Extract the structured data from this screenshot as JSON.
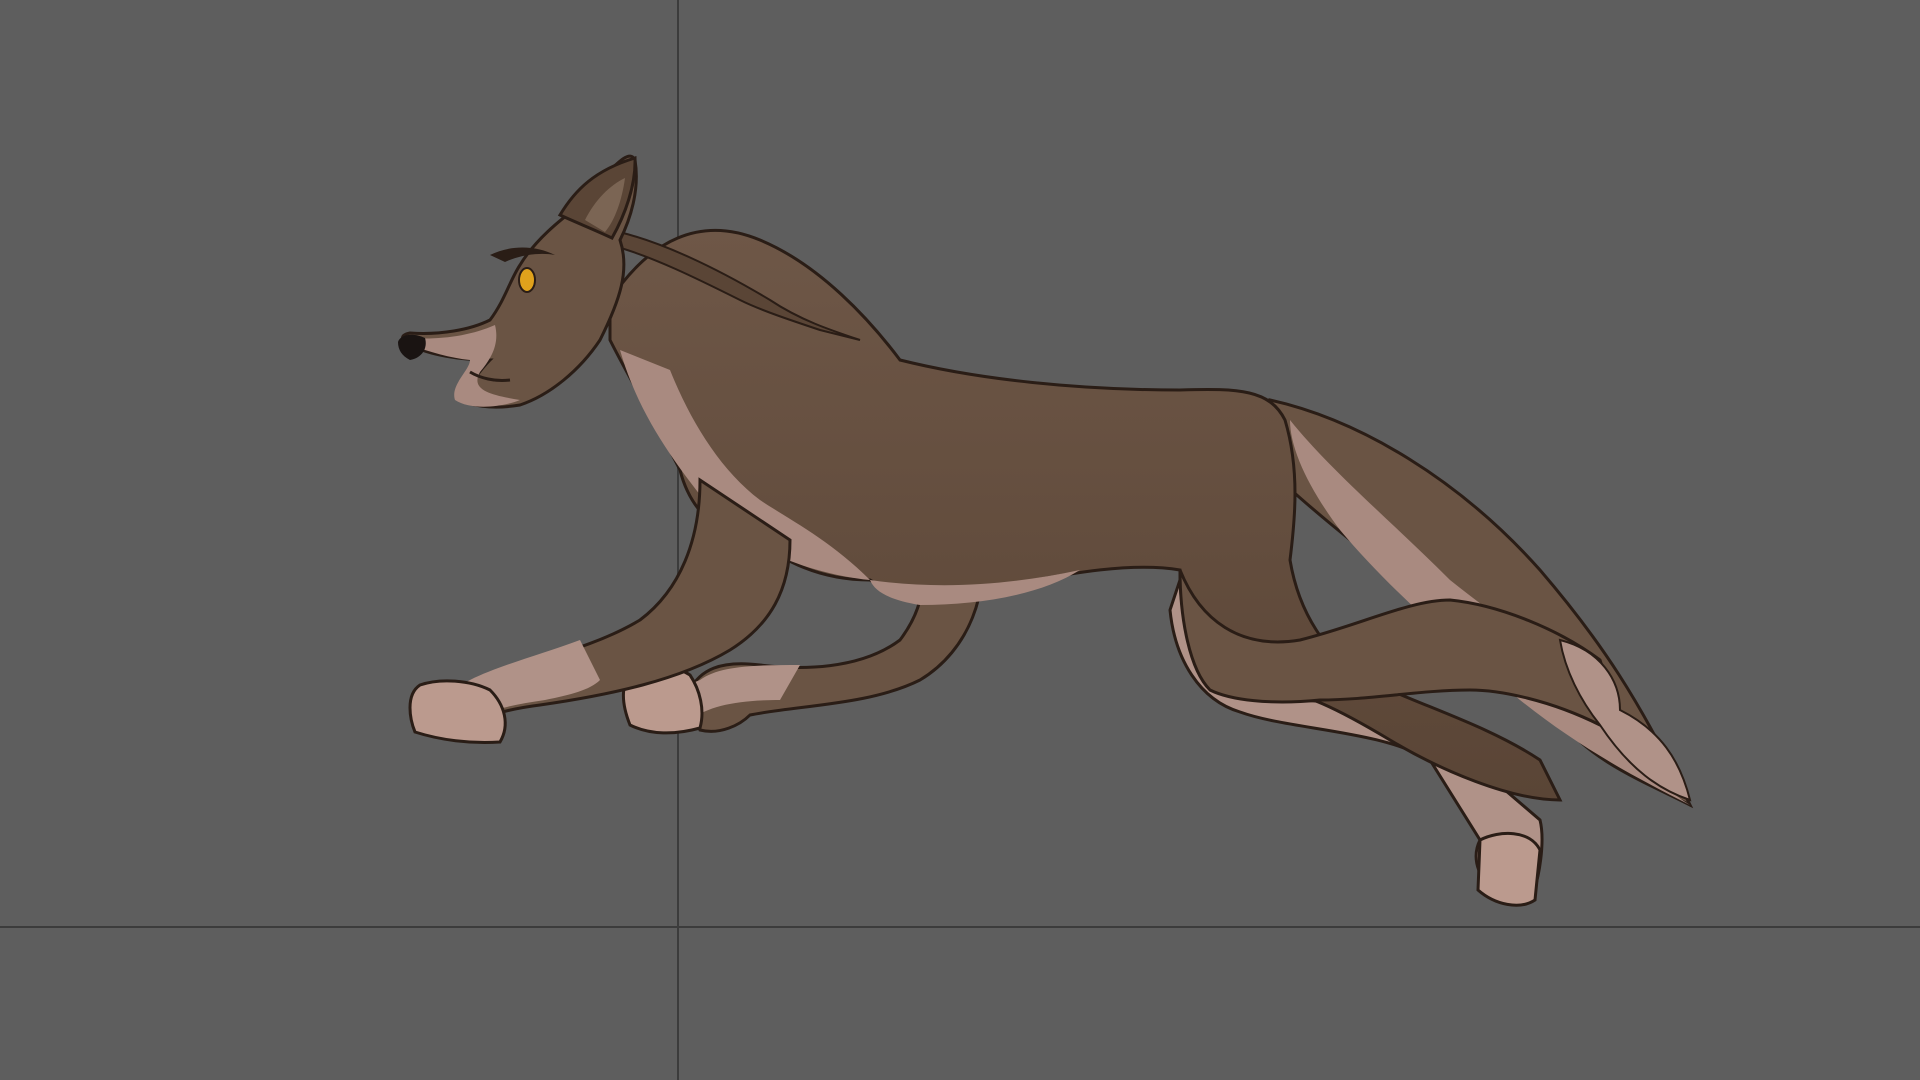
{
  "viewport": {
    "background_color": "#5e5e5e",
    "grid_line_color": "#3c3c3c"
  },
  "model": {
    "subject": "running-wolf",
    "colors": {
      "fur_main": "#6a5444",
      "fur_shadow": "#544234",
      "fur_light": "#7b6554",
      "underbelly": "#a98a80",
      "paw": "#b9988c",
      "outline": "#2a1d16",
      "eye": "#e0a21c",
      "nose": "#1a1412"
    }
  }
}
